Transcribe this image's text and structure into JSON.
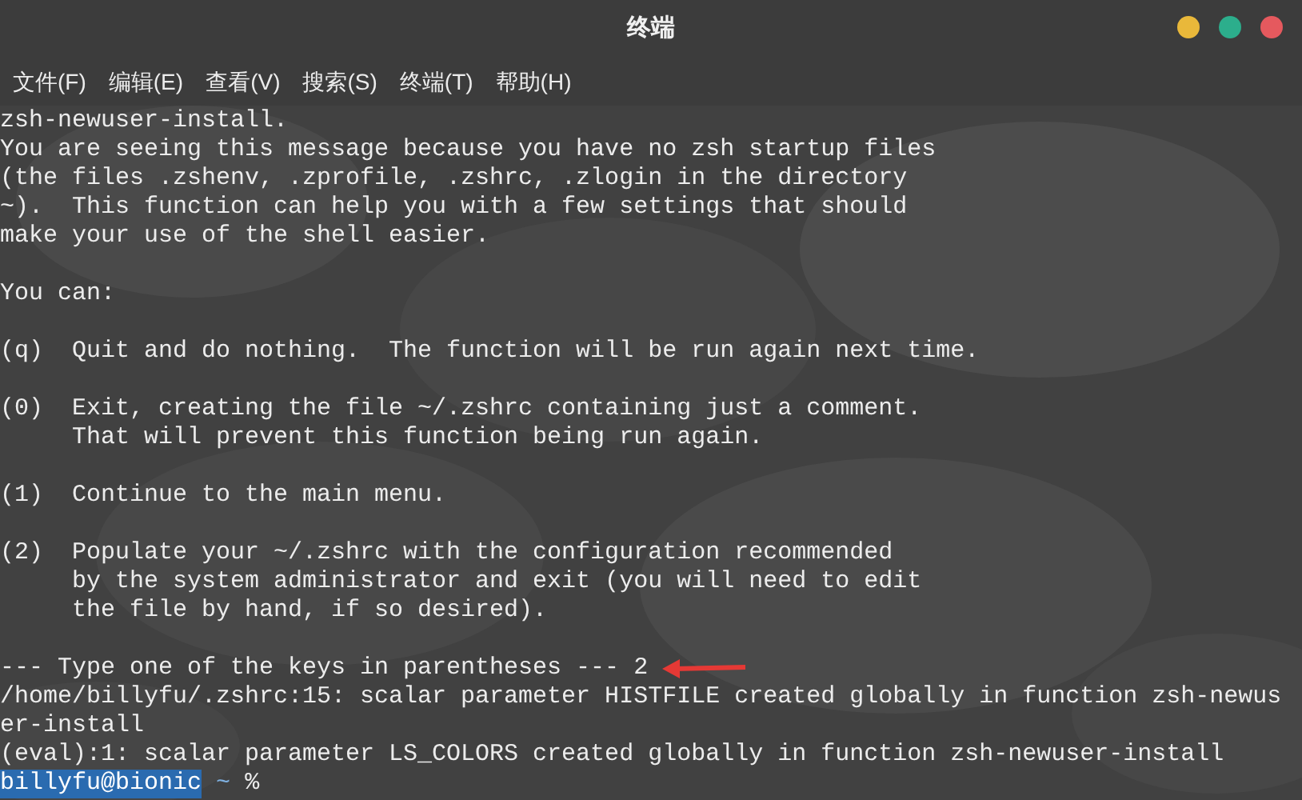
{
  "window": {
    "title": "终端"
  },
  "menu": [
    "文件(F)",
    "编辑(E)",
    "查看(V)",
    "搜索(S)",
    "终端(T)",
    "帮助(H)"
  ],
  "output": [
    {
      "lines": [
        "zsh-newuser-install.",
        "You are seeing this message because you have no zsh startup files",
        "(the files .zshenv, .zprofile, .zshrc, .zlogin in the directory",
        "~).  This function can help you with a few settings that should",
        "make your use of the shell easier."
      ]
    },
    {
      "lines": [
        "You can:"
      ]
    },
    {
      "lines": [
        "(q)  Quit and do nothing.  The function will be run again next time."
      ]
    },
    {
      "lines": [
        "(0)  Exit, creating the file ~/.zshrc containing just a comment.",
        "     That will prevent this function being run again."
      ]
    },
    {
      "lines": [
        "(1)  Continue to the main menu."
      ]
    },
    {
      "lines": [
        "(2)  Populate your ~/.zshrc with the configuration recommended",
        "     by the system administrator and exit (you will need to edit",
        "     the file by hand, if so desired)."
      ]
    },
    {
      "lines": [
        "--- Type one of the keys in parentheses --- 2",
        "/home/billyfu/.zshrc:15: scalar parameter HISTFILE created globally in function zsh-newus",
        "er-install",
        "(eval):1: scalar parameter LS_COLORS created globally in function zsh-newuser-install"
      ]
    }
  ],
  "prompt": {
    "user_host": "billyfu@bionic",
    "cwd": "~",
    "symbol": "%"
  }
}
